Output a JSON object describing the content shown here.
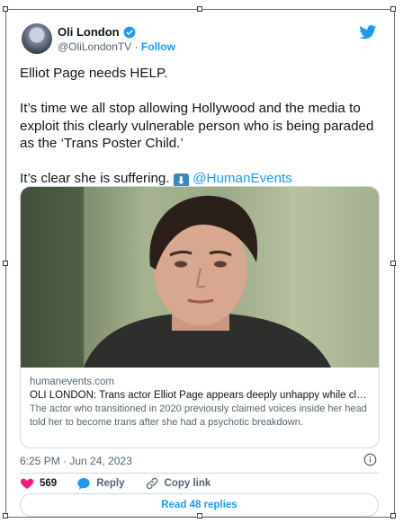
{
  "author": {
    "name": "Oli London",
    "handle": "@OliLondonTV",
    "separator": "·",
    "follow_label": "Follow"
  },
  "tweet": {
    "line1": "Elliot Page needs HELP.",
    "line2": "It’s time we all stop allowing Hollywood and the media to exploit this clearly vulnerable person who is being paraded as the ‘Trans Poster Child.’",
    "line3_text": "It’s clear she is suffering.",
    "line3_emoji": "⬇",
    "mention": "@HumanEvents"
  },
  "card": {
    "domain": "humanevents.com",
    "headline": "OLI LONDON: Trans actor Elliot Page appears deeply unhappy while clai...",
    "description": "The actor who transitioned in 2020 previously claimed voices inside her head told her to become trans after she had a psychotic breakdown."
  },
  "meta": {
    "timestamp": "6:25 PM · Jun 24, 2023"
  },
  "actions": {
    "like_count": "569",
    "reply_label": "Reply",
    "copy_label": "Copy link",
    "read_replies_label": "Read 48 replies"
  },
  "icons": {
    "verified": "verified-badge-icon",
    "bird": "twitter-bird-icon",
    "info": "info-icon",
    "heart": "heart-icon",
    "reply": "reply-bubble-icon",
    "link": "link-icon"
  },
  "colors": {
    "accent": "#1d9bf0",
    "heart": "#f91880",
    "text": "#0f1419",
    "muted": "#536471"
  }
}
